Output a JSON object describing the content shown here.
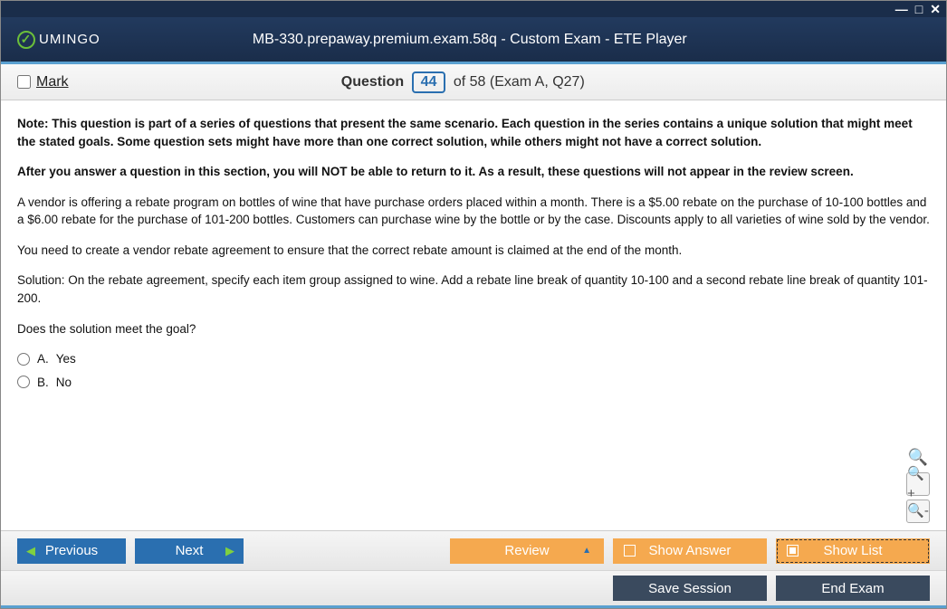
{
  "window": {
    "title": "MB-330.prepaway.premium.exam.58q - Custom Exam - ETE Player",
    "logo_text": "UMINGO"
  },
  "questionBar": {
    "mark_label": "Mark",
    "q_label": "Question",
    "q_number": "44",
    "q_total": " of 58 (Exam A, Q27)"
  },
  "content": {
    "note1": "Note: This question is part of a series of questions that present the same scenario. Each question in the series contains a unique solution that might meet the stated goals. Some question sets might have more than one correct solution, while others might not have a correct solution.",
    "note2": "After you answer a question in this section, you will NOT be able to return to it. As a result, these questions will not appear in the review screen.",
    "para1": "A vendor is offering a rebate program on bottles of wine that have purchase orders placed within a month. There is a $5.00 rebate on the purchase of 10-100 bottles and a $6.00 rebate for the purchase of 101-200 bottles. Customers can purchase wine by the bottle or by the case. Discounts apply to all varieties of wine sold by the vendor.",
    "para2": "You need to create a vendor rebate agreement to ensure that the correct rebate amount is claimed at the end of the month.",
    "para3": "Solution: On the rebate agreement, specify each item group assigned to wine. Add a rebate line break of quantity 10-100 and a second rebate line break of quantity 101-200.",
    "prompt": "Does the solution meet the goal?"
  },
  "answers": [
    {
      "letter": "A.",
      "text": "Yes"
    },
    {
      "letter": "B.",
      "text": "No"
    }
  ],
  "footer": {
    "previous": "Previous",
    "next": "Next",
    "review": "Review",
    "show_answer": "Show Answer",
    "show_list": "Show List",
    "save_session": "Save Session",
    "end_exam": "End Exam"
  }
}
